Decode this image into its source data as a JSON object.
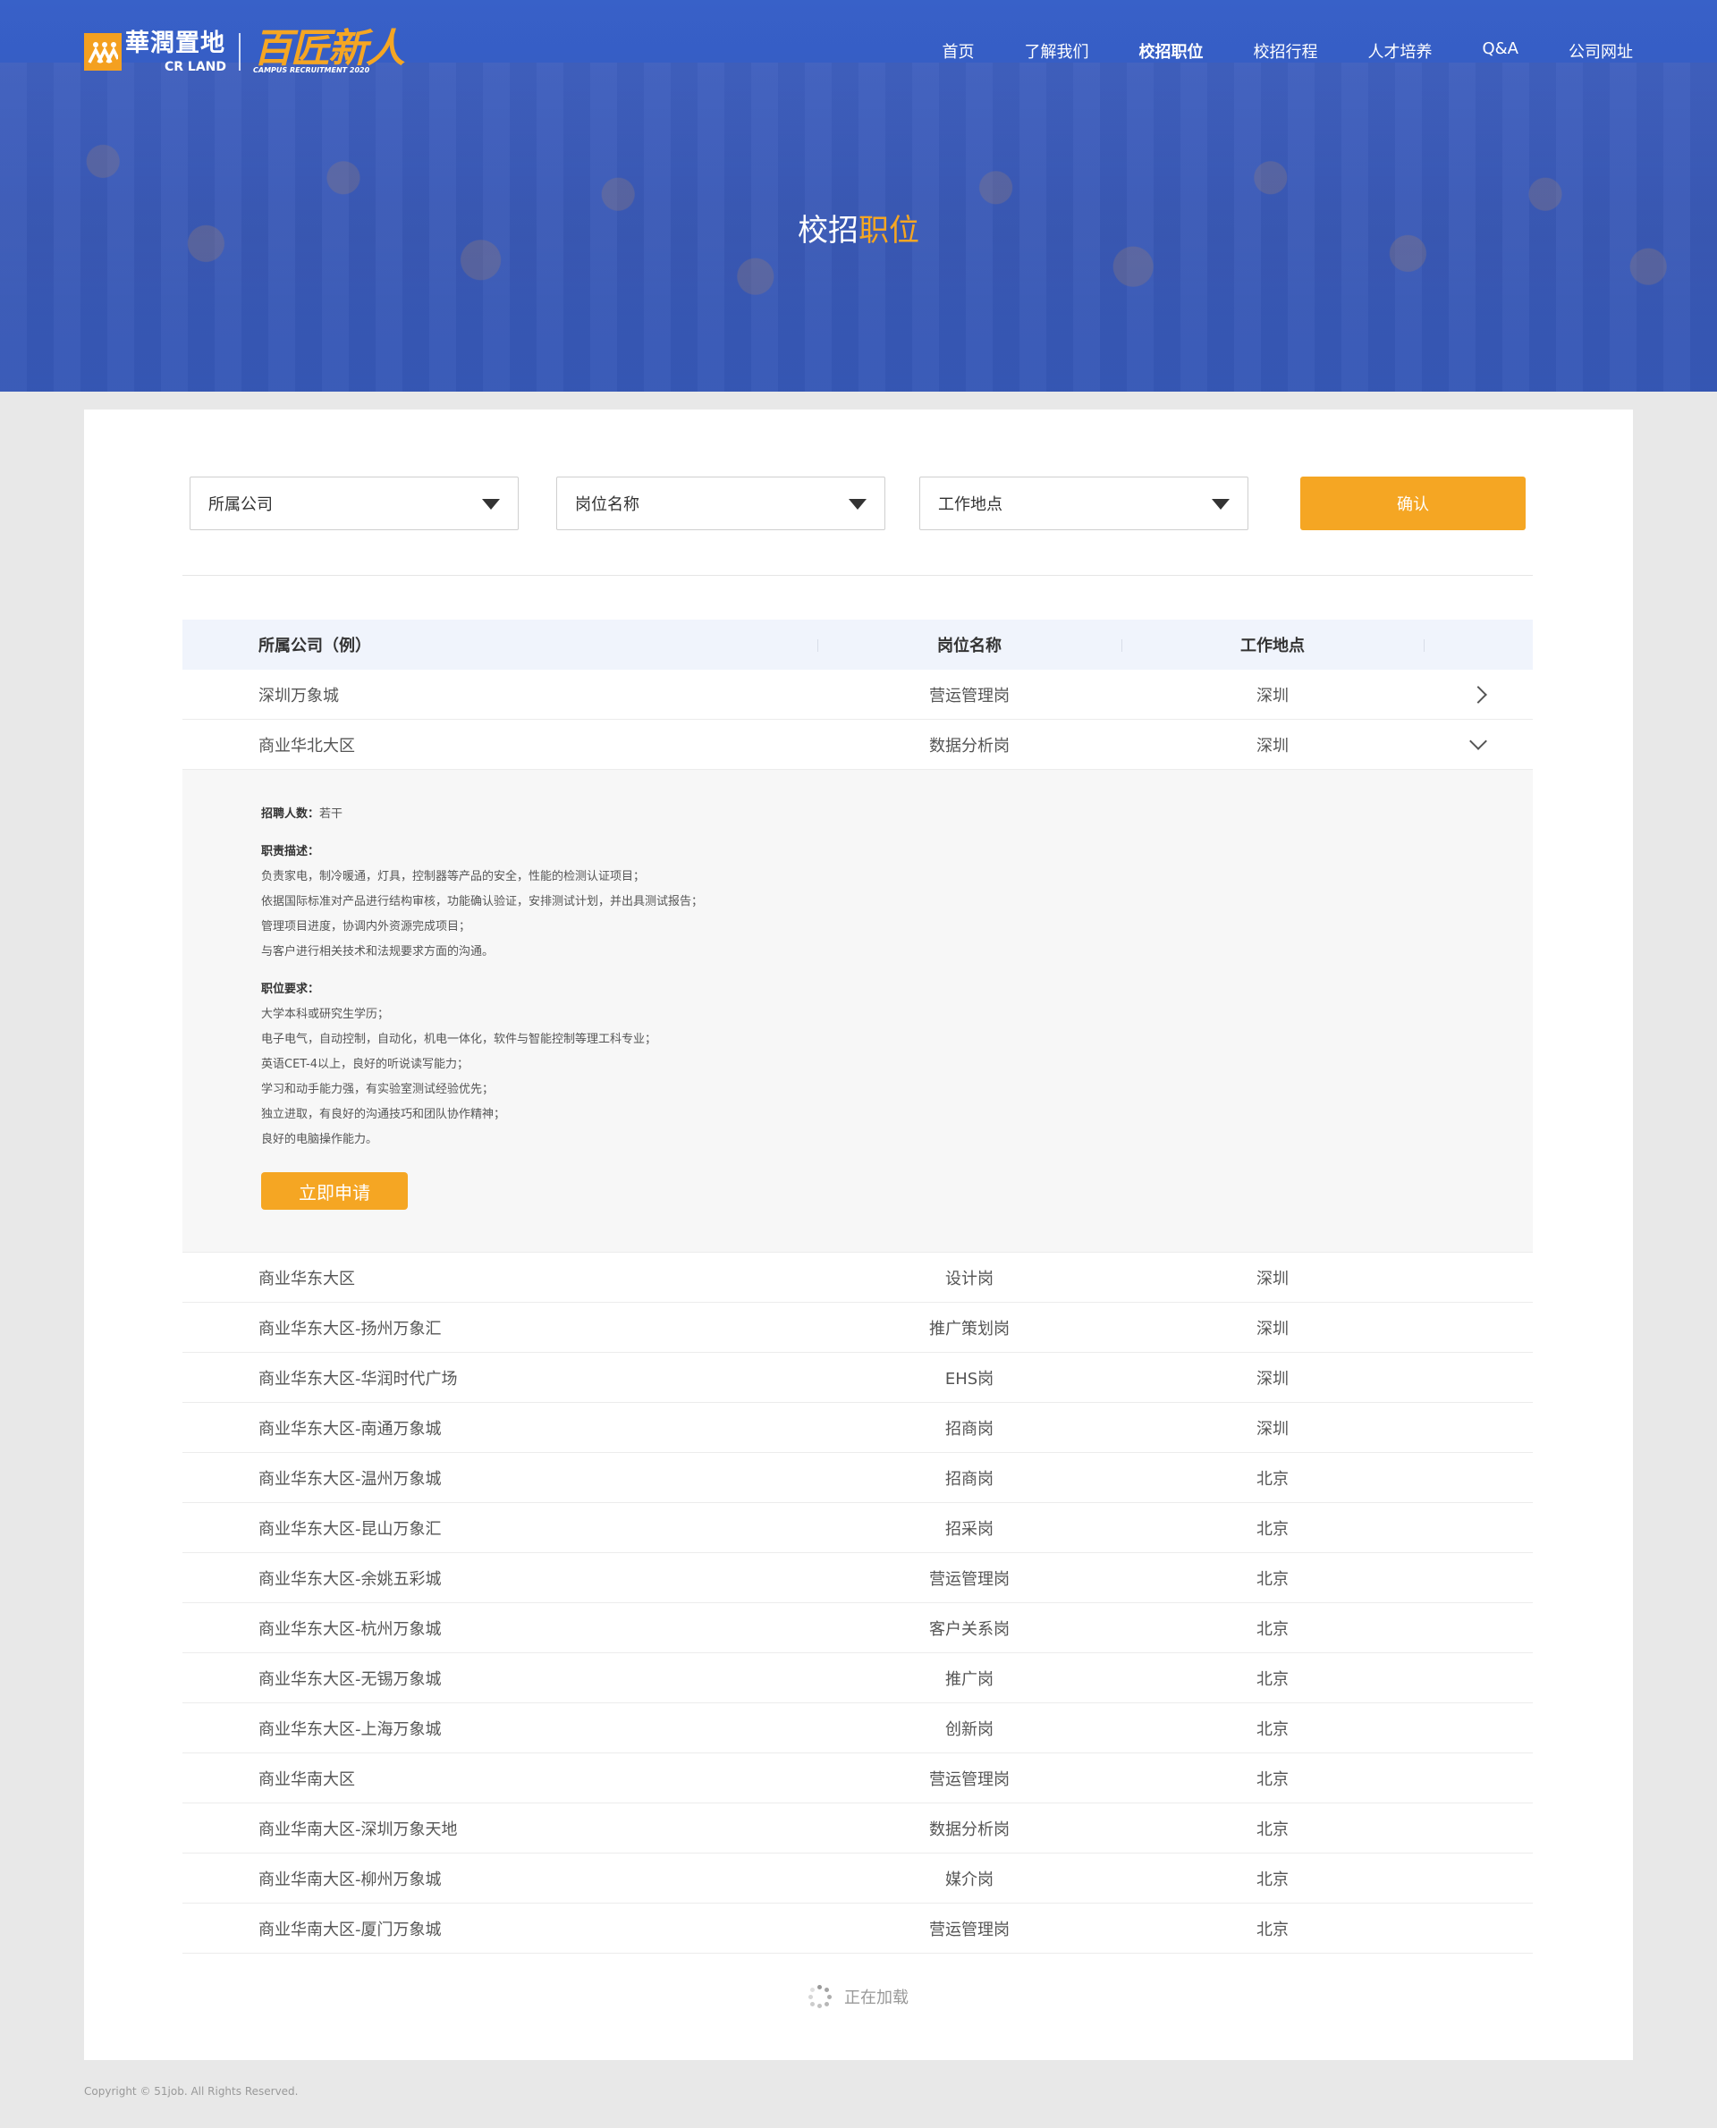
{
  "header": {
    "brand_cn": "華潤置地",
    "brand_en": "CR LAND",
    "campaign_cn": "百匠新人",
    "campaign_en": "CAMPUS RECRUITMENT 2020",
    "nav": [
      {
        "label": "首页",
        "active": false
      },
      {
        "label": "了解我们",
        "active": false
      },
      {
        "label": "校招职位",
        "active": true
      },
      {
        "label": "校招行程",
        "active": false
      },
      {
        "label": "人才培养",
        "active": false
      },
      {
        "label": "Q&A",
        "active": false
      },
      {
        "label": "公司网址",
        "active": false
      }
    ],
    "title_main": "校招",
    "title_accent": "职位"
  },
  "filters": {
    "company": "所属公司",
    "position": "岗位名称",
    "location": "工作地点",
    "confirm": "确认"
  },
  "table": {
    "headers": [
      "所属公司（例）",
      "岗位名称",
      "工作地点"
    ],
    "rows_top": [
      {
        "company": "深圳万象城",
        "position": "营运管理岗",
        "location": "深圳"
      },
      {
        "company": "商业华北大区",
        "position": "数据分析岗",
        "location": "深圳"
      }
    ],
    "detail": {
      "count_label": "招聘人数：",
      "count_value": "若干",
      "duty_label": "职责描述：",
      "duties": [
        "负责家电，制冷暖通，灯具，控制器等产品的安全，性能的检测认证项目；",
        "依据国际标准对产品进行结构审核，功能确认验证，安排测试计划，并出具测试报告；",
        "管理项目进度，协调内外资源完成项目；",
        "与客户进行相关技术和法规要求方面的沟通。"
      ],
      "req_label": "职位要求：",
      "requirements": [
        "大学本科或研究生学历；",
        "电子电气，自动控制，自动化，机电一体化，软件与智能控制等理工科专业；",
        "英语CET-4以上，良好的听说读写能力；",
        "学习和动手能力强，有实验室测试经验优先；",
        "独立进取，有良好的沟通技巧和团队协作精神；",
        "良好的电脑操作能力。"
      ],
      "apply": "立即申请"
    },
    "rows_bottom": [
      {
        "company": "商业华东大区",
        "position": "设计岗",
        "location": "深圳"
      },
      {
        "company": "商业华东大区-扬州万象汇",
        "position": "推广策划岗",
        "location": "深圳"
      },
      {
        "company": "商业华东大区-华润时代广场",
        "position": "EHS岗",
        "location": "深圳"
      },
      {
        "company": "商业华东大区-南通万象城",
        "position": "招商岗",
        "location": "深圳"
      },
      {
        "company": "商业华东大区-温州万象城",
        "position": "招商岗",
        "location": "北京"
      },
      {
        "company": "商业华东大区-昆山万象汇",
        "position": "招采岗",
        "location": "北京"
      },
      {
        "company": "商业华东大区-余姚五彩城",
        "position": "营运管理岗",
        "location": "北京"
      },
      {
        "company": "商业华东大区-杭州万象城",
        "position": "客户关系岗",
        "location": "北京"
      },
      {
        "company": "商业华东大区-无锡万象城",
        "position": "推广岗",
        "location": "北京"
      },
      {
        "company": "商业华东大区-上海万象城",
        "position": "创新岗",
        "location": "北京"
      },
      {
        "company": "商业华南大区",
        "position": "营运管理岗",
        "location": "北京"
      },
      {
        "company": "商业华南大区-深圳万象天地",
        "position": "数据分析岗",
        "location": "北京"
      },
      {
        "company": "商业华南大区-柳州万象城",
        "position": "媒介岗",
        "location": "北京"
      },
      {
        "company": "商业华南大区-厦门万象城",
        "position": "营运管理岗",
        "location": "北京"
      }
    ]
  },
  "loading": "正在加载",
  "footer": "Copyright © 51job. All Rights Reserved.",
  "colors": {
    "accent": "#f5a623",
    "hero_blue": "#3a63c8"
  }
}
